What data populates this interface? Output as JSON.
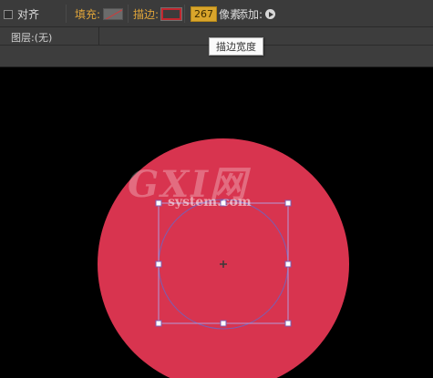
{
  "toolbar": {
    "align_label": "对齐",
    "fill_label": "填充:",
    "stroke_label": "描边:",
    "stroke_width_value": "267",
    "unit_label": "像素",
    "add_label": "添加:"
  },
  "layer": {
    "label": "图层:(无)"
  },
  "tooltip": {
    "text": "描边宽度"
  },
  "watermark": {
    "brand": "GXI网",
    "domain": "system.com"
  },
  "colors": {
    "circle_fill": "#d8344f",
    "stroke_swatch": "#c0262e",
    "stroke_value_bg": "#d9a52b",
    "label_orange": "#e0a53a",
    "selection": "#7a5fb3"
  }
}
